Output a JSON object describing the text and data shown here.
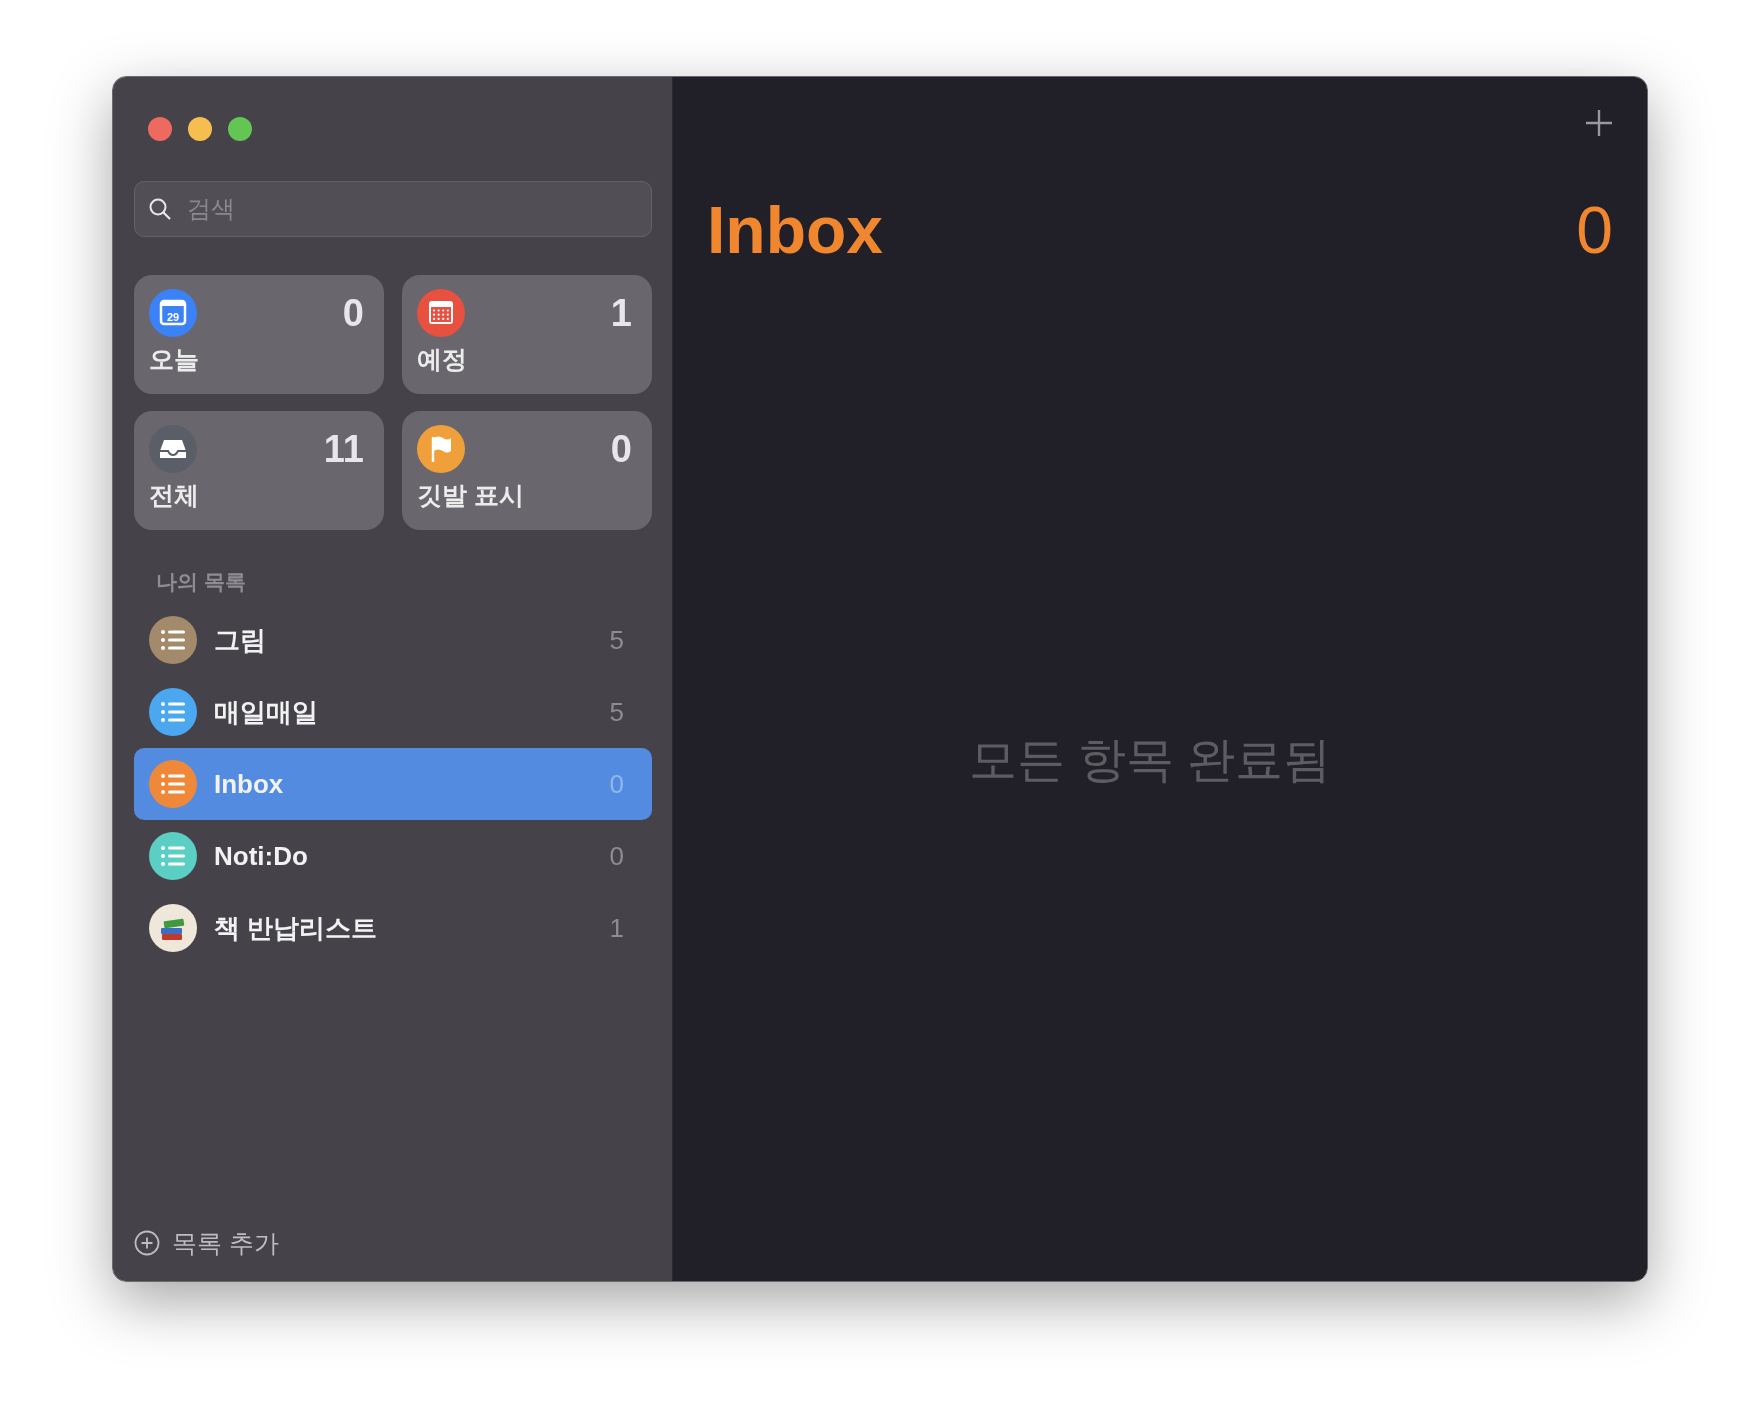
{
  "search": {
    "placeholder": "검색"
  },
  "smart_lists": [
    {
      "kind": "today",
      "label": "오늘",
      "count": "0",
      "icon_text": "29",
      "color": "#3b82f6"
    },
    {
      "kind": "scheduled",
      "label": "예정",
      "count": "1",
      "color": "#e8503f"
    },
    {
      "kind": "all",
      "label": "전체",
      "count": "11",
      "color": "#5a5e66"
    },
    {
      "kind": "flagged",
      "label": "깃발 표시",
      "count": "0",
      "color": "#f0a03a"
    }
  ],
  "section_title": "나의 목록",
  "lists": [
    {
      "kind": "list",
      "name": "그림",
      "count": "5",
      "color": "#a28a6a",
      "selected": false
    },
    {
      "kind": "list",
      "name": "매일매일",
      "count": "5",
      "color": "#4ba8f0",
      "selected": false
    },
    {
      "kind": "list",
      "name": "Inbox",
      "count": "0",
      "color": "#f0883a",
      "selected": true
    },
    {
      "kind": "list",
      "name": "Noti:Do",
      "count": "0",
      "color": "#5ccfc4",
      "selected": false
    },
    {
      "kind": "books",
      "name": "책 반납리스트",
      "count": "1",
      "color": "#efe7da",
      "selected": false
    }
  ],
  "add_list": "목록 추가",
  "main": {
    "title": "Inbox",
    "count": "0",
    "empty_message": "모든 항목 완료됨"
  }
}
